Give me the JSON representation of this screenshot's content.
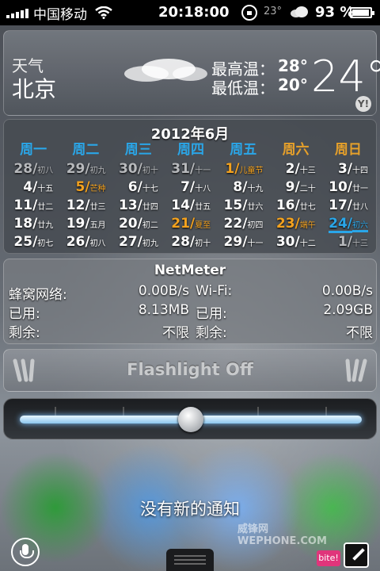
{
  "status_bar": {
    "carrier": "中国移动",
    "time": "20:18:00",
    "temp": "23°",
    "battery": "93 %"
  },
  "weather": {
    "label": "天气",
    "city": "北京",
    "high_label": "最高温：",
    "high": "28°",
    "low_label": "最低温：",
    "low": "20°",
    "current": "24°",
    "condition_icon": "cloud-icon",
    "provider_icon": "yahoo-icon"
  },
  "calendar": {
    "title": "2012年6月",
    "weekdays": [
      "周一",
      "周二",
      "周三",
      "周四",
      "周五",
      "周六",
      "周日"
    ],
    "weeks": [
      [
        {
          "d": "28/",
          "l": "初八",
          "s": "dim"
        },
        {
          "d": "29/",
          "l": "初九",
          "s": "dim"
        },
        {
          "d": "30/",
          "l": "初十",
          "s": "dim"
        },
        {
          "d": "31/",
          "l": "十一",
          "s": "dim"
        },
        {
          "d": "1/",
          "l": "儿童节",
          "s": "hol"
        },
        {
          "d": "2/",
          "l": "十三",
          "s": ""
        },
        {
          "d": "3/",
          "l": "十四",
          "s": ""
        }
      ],
      [
        {
          "d": "4/",
          "l": "十五",
          "s": ""
        },
        {
          "d": "5/",
          "l": "芒种",
          "s": "hol"
        },
        {
          "d": "6/",
          "l": "十七",
          "s": ""
        },
        {
          "d": "7/",
          "l": "十八",
          "s": ""
        },
        {
          "d": "8/",
          "l": "十九",
          "s": ""
        },
        {
          "d": "9/",
          "l": "二十",
          "s": ""
        },
        {
          "d": "10/",
          "l": "廿一",
          "s": ""
        }
      ],
      [
        {
          "d": "11/",
          "l": "廿二",
          "s": ""
        },
        {
          "d": "12/",
          "l": "廿三",
          "s": ""
        },
        {
          "d": "13/",
          "l": "廿四",
          "s": ""
        },
        {
          "d": "14/",
          "l": "廿五",
          "s": ""
        },
        {
          "d": "15/",
          "l": "廿六",
          "s": ""
        },
        {
          "d": "16/",
          "l": "廿七",
          "s": ""
        },
        {
          "d": "17/",
          "l": "廿八",
          "s": ""
        }
      ],
      [
        {
          "d": "18/",
          "l": "廿九",
          "s": ""
        },
        {
          "d": "19/",
          "l": "五月",
          "s": ""
        },
        {
          "d": "20/",
          "l": "初二",
          "s": ""
        },
        {
          "d": "21/",
          "l": "夏至",
          "s": "hol"
        },
        {
          "d": "22/",
          "l": "初四",
          "s": ""
        },
        {
          "d": "23/",
          "l": "端午",
          "s": "hol"
        },
        {
          "d": "24/",
          "l": "初六",
          "s": "today"
        }
      ],
      [
        {
          "d": "25/",
          "l": "初七",
          "s": ""
        },
        {
          "d": "26/",
          "l": "初八",
          "s": ""
        },
        {
          "d": "27/",
          "l": "初九",
          "s": ""
        },
        {
          "d": "28/",
          "l": "初十",
          "s": ""
        },
        {
          "d": "29/",
          "l": "十一",
          "s": ""
        },
        {
          "d": "30/",
          "l": "十二",
          "s": ""
        },
        {
          "d": "1/",
          "l": "十三",
          "s": "dim"
        }
      ]
    ]
  },
  "netmeter": {
    "title": "NetMeter",
    "rows": [
      {
        "k1": "蜂窝网络:",
        "v1": "0.00B/s",
        "k2": "Wi-Fi:",
        "v2": "0.00B/s"
      },
      {
        "k1": "已用:",
        "v1": "8.13MB",
        "k2": "已用:",
        "v2": "2.09GB"
      },
      {
        "k1": "剩余:",
        "v1": "不限",
        "k2": "剩余:",
        "v2": "不限"
      }
    ]
  },
  "flashlight": {
    "label": "Flashlight Off"
  },
  "brightness": {
    "level": 0.5
  },
  "notifications": {
    "empty_text": "没有新的通知"
  },
  "bottom": {
    "watermark": "威锋网 WEPHONE.COM",
    "bite_label": "bite!"
  },
  "colors": {
    "weekday": "#2aa6e8",
    "weekend": "#e6a02a",
    "holiday": "#f4a21e",
    "today": "#2aa6e8"
  }
}
